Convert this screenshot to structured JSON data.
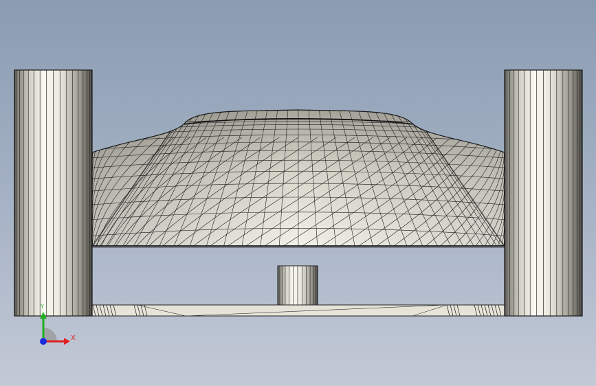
{
  "viewport": {
    "background_top": "#8a9cb1",
    "background_bottom": "#c3cad6"
  },
  "model": {
    "parts": [
      "left-cylinder",
      "right-cylinder",
      "dome-shell",
      "center-post",
      "base-plate"
    ],
    "edge_color": "#1a1a1a",
    "face_light": "#f4f3ea",
    "face_dark": "#5b5b55"
  },
  "triad": {
    "x_label": "X",
    "y_label": "Y",
    "x_color": "#e02020",
    "y_color": "#20b020",
    "z_color": "#1a2bdd"
  }
}
